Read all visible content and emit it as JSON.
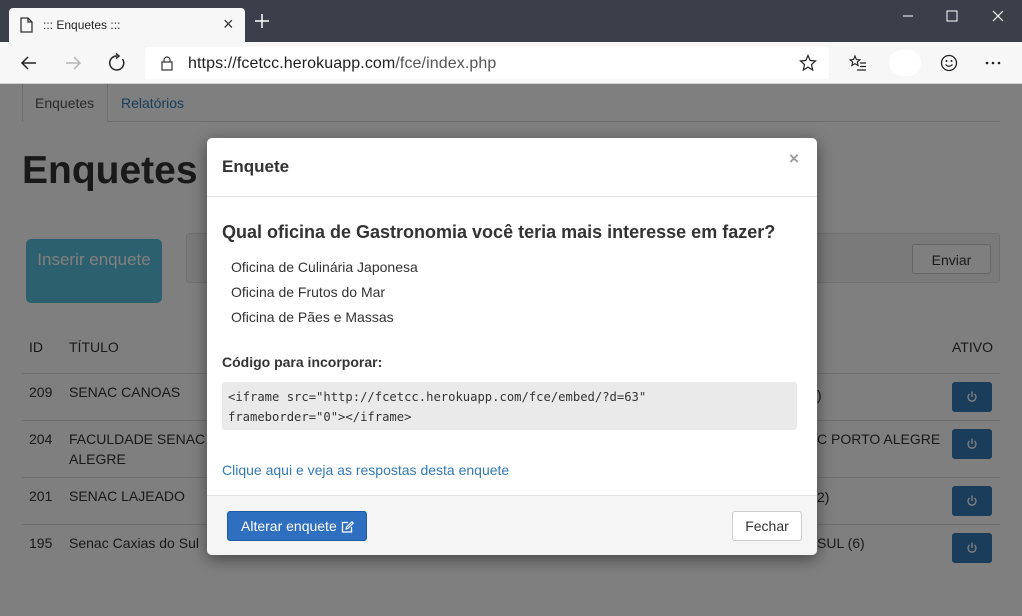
{
  "browser": {
    "tab_title": "::: Enquetes :::",
    "url_host": "https://fcetcc.herokuapp.com",
    "url_path": "/fce/index.php"
  },
  "page": {
    "nav_tabs": [
      "Enquetes",
      "Relatórios"
    ],
    "heading": "Enquetes",
    "insert_button": "Inserir enquete",
    "send_button": "Enviar",
    "table": {
      "headers": [
        "ID",
        "TÍTULO",
        "ATIVO"
      ],
      "rows": [
        {
          "id": "209",
          "title": "SENAC CANOAS",
          "right": ")"
        },
        {
          "id": "204",
          "title": "FACULDADE SENAC ALEGRE",
          "right": "C PORTO ALEGRE"
        },
        {
          "id": "201",
          "title": "SENAC LAJEADO",
          "right": "2)"
        },
        {
          "id": "195",
          "title": "Senac Caxias do Sul",
          "right": "SUL (6)"
        }
      ]
    }
  },
  "modal": {
    "title": "Enquete",
    "close": "×",
    "question": "Qual oficina de Gastronomia você teria mais interesse em fazer?",
    "options": [
      "Oficina de Culinária Japonesa",
      "Oficina de Frutos do Mar",
      "Oficina de Pães e Massas"
    ],
    "embed_label": "Código para incorporar:",
    "embed_code_line1": "<iframe src=\"http://fcetcc.herokuapp.com/fce/embed/?d=63\"",
    "embed_code_line2": "frameborder=\"0\"></iframe>",
    "results_link": "Clique aqui e veja as respostas desta enquete",
    "edit_button": "Alterar enquete",
    "close_button": "Fechar"
  },
  "colors": {
    "titlebar": "#3b3f4a",
    "primary": "#337ab7",
    "info": "#5bc0de"
  }
}
